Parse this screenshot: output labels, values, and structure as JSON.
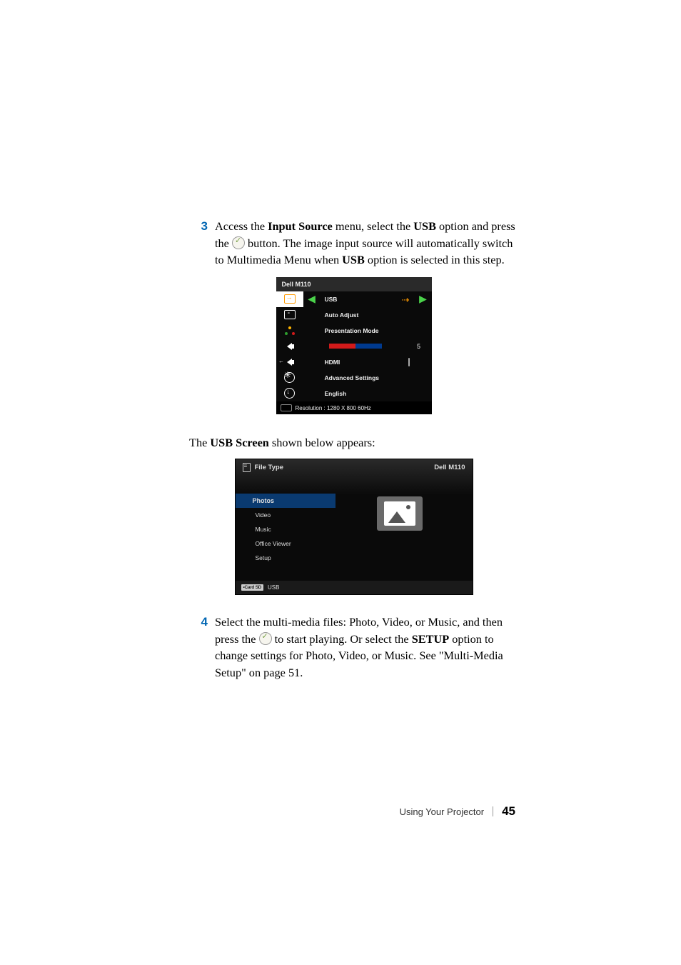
{
  "steps": {
    "s3": {
      "number": "3",
      "text_before": "Access the ",
      "bold1": "Input Source",
      "text_mid1": " menu, select the ",
      "bold2": "USB",
      "text_mid2": " option and press the ",
      "text_after": " button. The image input source will automatically switch to Multimedia Menu when ",
      "bold3": "USB",
      "text_end": " option is selected in this step."
    },
    "s4": {
      "number": "4",
      "text_before": "Select the multi-media files: Photo, Video, or Music, and then press the ",
      "text_mid": " to start playing. Or select the ",
      "bold1": "SETUP",
      "text_after": " option to change settings for Photo, Video, or Music. See \"Multi-Media Setup\" on page 51."
    }
  },
  "menu1": {
    "title": "Dell   M110",
    "rows": {
      "usb": "USB",
      "auto_adjust": "Auto Adjust",
      "presentation_mode": "Presentation Mode",
      "slider_value": "5",
      "hdmi": "HDMI",
      "advanced": "Advanced Settings",
      "english": "English"
    },
    "footer": "Resolution : 1280 X 800 60Hz"
  },
  "caption": {
    "before": "The ",
    "bold": "USB Screen",
    "after": " shown below appears:"
  },
  "usb_screen": {
    "header_left": "File Type",
    "header_right": "Dell M110",
    "items": {
      "photos": "Photos",
      "video": "Video",
      "music": "Music",
      "office": "Office Viewer",
      "setup": "Setup"
    },
    "footer_badge": "•Card   SD",
    "footer_text": "USB"
  },
  "footer": {
    "section": "Using Your Projector",
    "page": "45"
  }
}
